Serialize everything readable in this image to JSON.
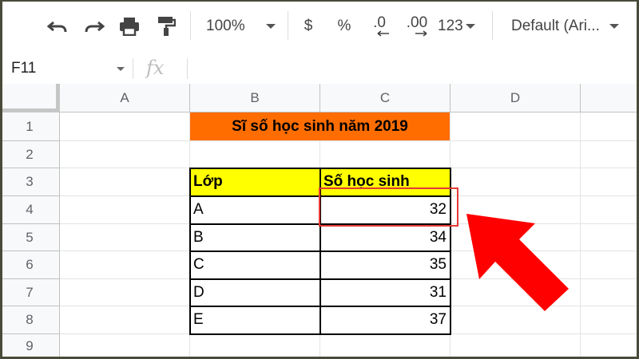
{
  "toolbar": {
    "zoom": "100%",
    "currency": "$",
    "percent": "%",
    "dec_decrease": ".0",
    "dec_increase": ".00",
    "number_format": "123",
    "font": "Default (Ari..."
  },
  "formula_bar": {
    "cell_ref": "F11",
    "fx_label": "fx"
  },
  "columns": [
    "A",
    "B",
    "C",
    "D"
  ],
  "rows": [
    "1",
    "2",
    "3",
    "4",
    "5",
    "6",
    "7",
    "8",
    "9"
  ],
  "sheet": {
    "title": "Sĩ số học sinh năm 2019",
    "header_class": "Lớp",
    "header_count": "Số học sinh",
    "data": [
      {
        "class": "A",
        "count": "32"
      },
      {
        "class": "B",
        "count": "34"
      },
      {
        "class": "C",
        "count": "35"
      },
      {
        "class": "D",
        "count": "31"
      },
      {
        "class": "E",
        "count": "37"
      }
    ]
  },
  "colors": {
    "title_fill": "#ff6d01",
    "header_fill": "#ffff00",
    "highlight": "#e53935",
    "arrow": "#ff0000"
  }
}
